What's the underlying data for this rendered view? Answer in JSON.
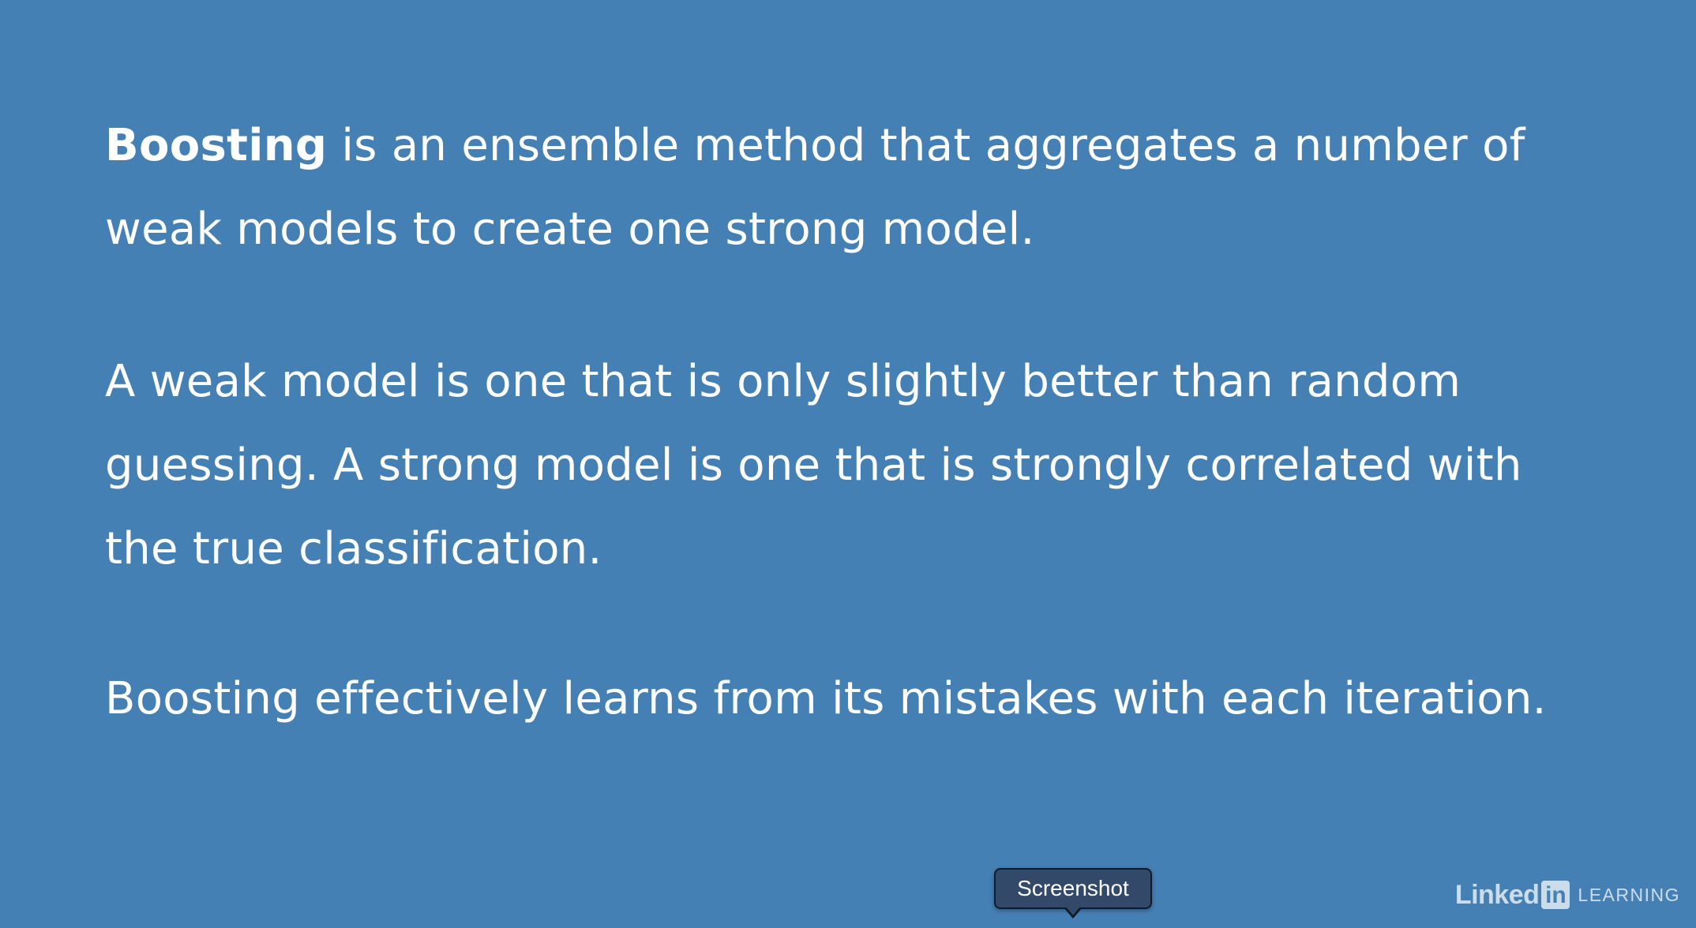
{
  "slide": {
    "para1": {
      "bold": "Boosting",
      "line1_rest": " is an ensemble method that aggregates a number of",
      "line2": "weak models to create one strong model."
    },
    "para2": {
      "line1": "A weak model is one that is only slightly better than random",
      "line2": "guessing. A strong model is one that is strongly correlated with",
      "line3": "the true classification."
    },
    "para3": {
      "line1": "Boosting effectively learns from its mistakes with each iteration."
    }
  },
  "tooltip": {
    "label": "Screenshot"
  },
  "brand": {
    "linked": "Linked",
    "in": "in",
    "learning": "LEARNING"
  },
  "colors": {
    "background": "#4580b5",
    "text": "#ffffff",
    "tooltip_bg": "#32496a"
  }
}
